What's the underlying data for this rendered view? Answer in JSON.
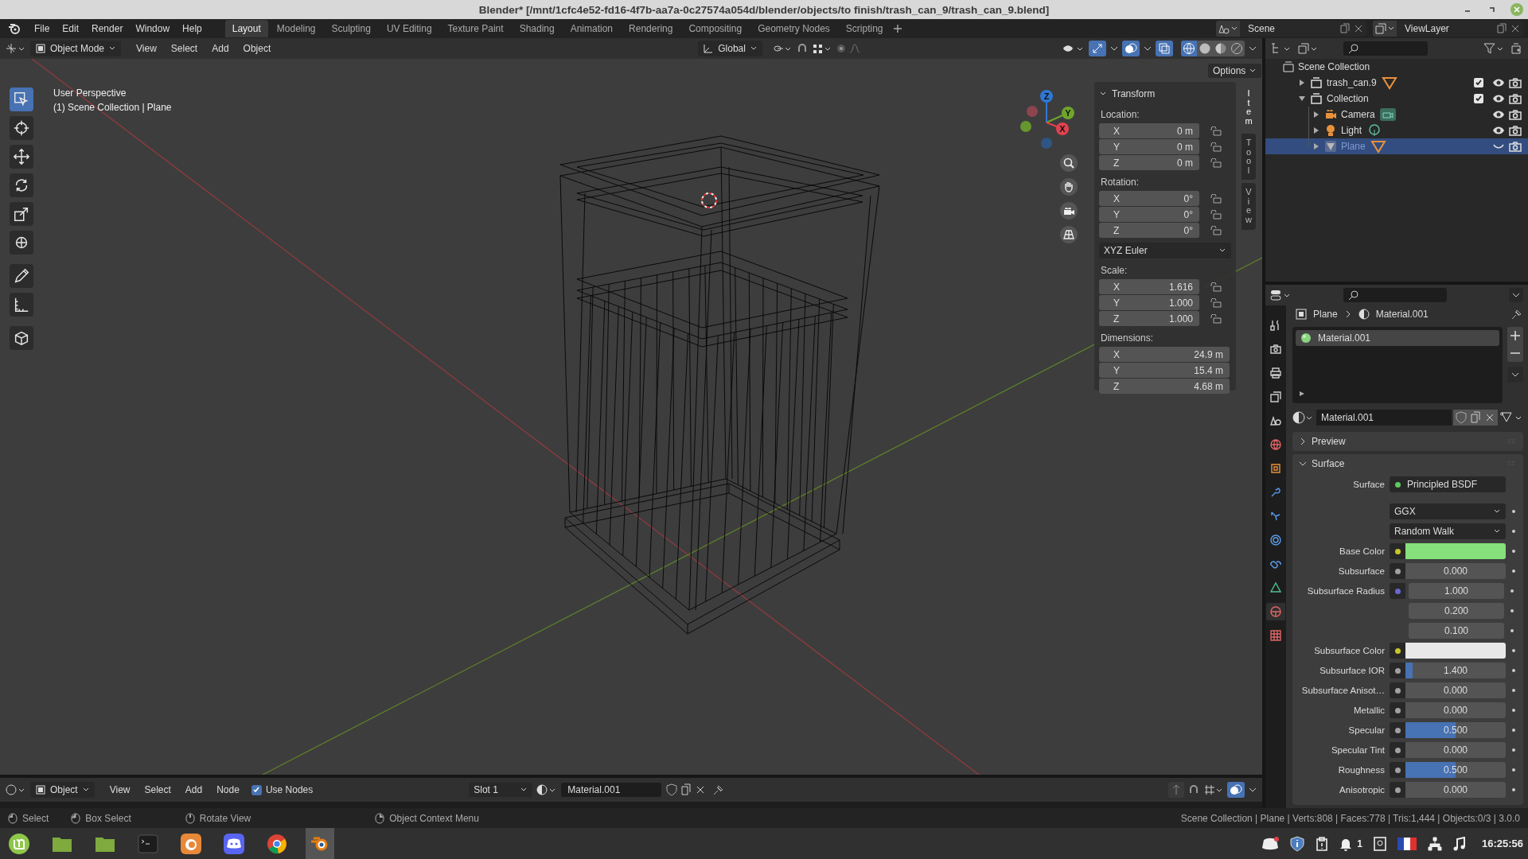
{
  "window": {
    "title": "Blender* [/mnt/1cfc4e52-fd16-4f7b-aa7a-0c27574a054d/blender/objects/to finish/trash_can_9/trash_can_9.blend]"
  },
  "menu_bar": {
    "items": [
      "File",
      "Edit",
      "Render",
      "Window",
      "Help"
    ]
  },
  "workspace_tabs": [
    {
      "label": "Layout",
      "selected": true
    },
    {
      "label": "Modeling",
      "selected": false
    },
    {
      "label": "Sculpting",
      "selected": false
    },
    {
      "label": "UV Editing",
      "selected": false
    },
    {
      "label": "Texture Paint",
      "selected": false
    },
    {
      "label": "Shading",
      "selected": false
    },
    {
      "label": "Animation",
      "selected": false
    },
    {
      "label": "Rendering",
      "selected": false
    },
    {
      "label": "Compositing",
      "selected": false
    },
    {
      "label": "Geometry Nodes",
      "selected": false
    },
    {
      "label": "Scripting",
      "selected": false
    }
  ],
  "scene": {
    "value": "Scene"
  },
  "view_layer": {
    "value": "ViewLayer"
  },
  "viewport": {
    "header": {
      "mode": "Object Mode",
      "menus": [
        "View",
        "Select",
        "Add",
        "Object"
      ],
      "orientation": "Global",
      "shading": [
        {
          "kind": "wireframe",
          "selected": true
        },
        {
          "kind": "solid",
          "selected": false
        },
        {
          "kind": "material",
          "selected": false
        },
        {
          "kind": "rendered",
          "selected": false
        }
      ]
    },
    "options": "Options",
    "tools": [
      {
        "kind": "select",
        "selected": true
      },
      {
        "kind": "cursor",
        "selected": false
      },
      {
        "kind": "move",
        "selected": false
      },
      {
        "kind": "rotate",
        "selected": false
      },
      {
        "kind": "scale",
        "selected": false
      },
      {
        "kind": "transform",
        "selected": false
      },
      {
        "kind": "annotate",
        "selected": false
      },
      {
        "kind": "measure",
        "selected": false
      },
      {
        "kind": "add",
        "selected": false
      }
    ],
    "overlay_text": [
      "User Perspective",
      "(1) Scene Collection | Plane"
    ],
    "gizmo_axes": [
      {
        "label": "Z",
        "color": "#2f78d4"
      },
      {
        "label": "Y",
        "color": "#6ea62c"
      },
      {
        "label": "X",
        "color": "#e2414f"
      }
    ],
    "sidebar_tabs": [
      {
        "label": "Item",
        "selected": true
      },
      {
        "label": "Tool",
        "selected": false
      },
      {
        "label": "View",
        "selected": false
      }
    ],
    "transform": {
      "title": "Transform",
      "expanded": true,
      "groups": [
        {
          "kind": "vector",
          "label": "Location:",
          "lockable": true,
          "fields": [
            {
              "axis": "X",
              "value": "0 m"
            },
            {
              "axis": "Y",
              "value": "0 m"
            },
            {
              "axis": "Z",
              "value": "0 m"
            }
          ]
        },
        {
          "kind": "vector",
          "label": "Rotation:",
          "lockable": true,
          "fields": [
            {
              "axis": "X",
              "value": "0°"
            },
            {
              "axis": "Y",
              "value": "0°"
            },
            {
              "axis": "Z",
              "value": "0°"
            }
          ]
        },
        {
          "kind": "dropdown",
          "value": "XYZ Euler"
        },
        {
          "kind": "vector",
          "label": "Scale:",
          "lockable": true,
          "fields": [
            {
              "axis": "X",
              "value": "1.616"
            },
            {
              "axis": "Y",
              "value": "1.000"
            },
            {
              "axis": "Z",
              "value": "1.000"
            }
          ]
        },
        {
          "kind": "vector",
          "label": "Dimensions:",
          "lockable": false,
          "fields": [
            {
              "axis": "X",
              "value": "24.9 m"
            },
            {
              "axis": "Y",
              "value": "15.4 m"
            },
            {
              "axis": "Z",
              "value": "4.68 m"
            }
          ]
        }
      ]
    }
  },
  "outliner": {
    "root": "Scene Collection",
    "items": [
      {
        "name": "trash_can.9",
        "kind": "collection",
        "data": [
          {
            "kind": "mesh"
          }
        ],
        "expanded": false,
        "checked": true,
        "visible": true,
        "selected": false
      },
      {
        "name": "Collection",
        "kind": "collection",
        "expanded": true,
        "checked": true,
        "visible": true,
        "selected": false,
        "children": [
          {
            "name": "Camera",
            "kind": "camera",
            "data": [
              {
                "kind": "camera"
              }
            ],
            "expanded": false,
            "visible": true,
            "selected": false
          },
          {
            "name": "Light",
            "kind": "light",
            "data": [
              {
                "kind": "light"
              }
            ],
            "expanded": false,
            "visible": true,
            "selected": false
          },
          {
            "name": "Plane",
            "kind": "mesh",
            "data": [
              {
                "kind": "mesh"
              }
            ],
            "expanded": false,
            "visible": false,
            "selected": true
          }
        ]
      }
    ]
  },
  "properties": {
    "tabs": [
      {
        "kind": "tool",
        "selected": false
      },
      {
        "kind": "render",
        "selected": false
      },
      {
        "kind": "output",
        "selected": false
      },
      {
        "kind": "view-layer",
        "selected": false
      },
      {
        "kind": "scene",
        "selected": false
      },
      {
        "kind": "world",
        "selected": false
      },
      {
        "kind": "object",
        "selected": false
      },
      {
        "kind": "modifier",
        "selected": false
      },
      {
        "kind": "particles",
        "selected": false
      },
      {
        "kind": "physics",
        "selected": false
      },
      {
        "kind": "constraints",
        "selected": false
      },
      {
        "kind": "data",
        "selected": false
      },
      {
        "kind": "material",
        "selected": true
      },
      {
        "kind": "texture",
        "selected": false
      }
    ],
    "breadcrumb": [
      "Plane",
      "Material.001"
    ],
    "slots": [
      {
        "name": "Material.001",
        "selected": true
      }
    ],
    "material": "Material.001",
    "panels": [
      {
        "title": "Preview",
        "expanded": false
      },
      {
        "title": "Surface",
        "expanded": true
      }
    ],
    "surface_rows": [
      {
        "kind": "shader",
        "label": "Surface",
        "value": "Principled BSDF"
      },
      {
        "kind": "dropdown",
        "value": "GGX"
      },
      {
        "kind": "dropdown",
        "value": "Random Walk"
      },
      {
        "kind": "color",
        "label": "Base Color",
        "color": "#86e07b"
      },
      {
        "kind": "number",
        "label": "Subsurface",
        "value": "0.000",
        "level": 0
      },
      {
        "kind": "vector",
        "label": "Subsurface Radius",
        "values": [
          "1.000",
          "0.200",
          "0.100"
        ]
      },
      {
        "kind": "color",
        "label": "Subsurface Color",
        "color": "#e8e8e8"
      },
      {
        "kind": "number",
        "label": "Subsurface IOR",
        "value": "1.400",
        "level": 0.07
      },
      {
        "kind": "number",
        "label": "Subsurface Anisot…",
        "value": "0.000",
        "level": 0
      },
      {
        "kind": "number",
        "label": "Metallic",
        "value": "0.000",
        "level": 0
      },
      {
        "kind": "number",
        "label": "Specular",
        "value": "0.500",
        "level": 0.5
      },
      {
        "kind": "number",
        "label": "Specular Tint",
        "value": "0.000",
        "level": 0
      },
      {
        "kind": "number",
        "label": "Roughness",
        "value": "0.500",
        "level": 0.5
      },
      {
        "kind": "number",
        "label": "Anisotropic",
        "value": "0.000",
        "level": 0
      }
    ]
  },
  "node_editor_header": {
    "mode": "Object",
    "menus": [
      "View",
      "Select",
      "Add",
      "Node"
    ],
    "use_nodes": {
      "label": "Use Nodes",
      "checked": true
    },
    "slot": "Slot 1",
    "material": "Material.001"
  },
  "status_bar": {
    "hints": [
      {
        "kind": "left",
        "label": "Select"
      },
      {
        "kind": "drag",
        "label": "Box Select"
      },
      {
        "kind": "middle",
        "label": "Rotate View"
      },
      {
        "kind": "right",
        "label": "Object Context Menu"
      }
    ],
    "stats": "Scene Collection | Plane | Verts:808 | Faces:778 | Tris:1,444 | Objects:0/3 | 3.0.0"
  },
  "taskbar": {
    "apps": [
      {
        "kind": "mint",
        "active": false
      },
      {
        "kind": "folder",
        "active": false
      },
      {
        "kind": "folder",
        "active": false
      },
      {
        "kind": "terminal",
        "active": false
      },
      {
        "kind": "firefox",
        "active": false
      },
      {
        "kind": "discord",
        "active": false
      },
      {
        "kind": "chrome",
        "active": false
      },
      {
        "kind": "blender",
        "active": true
      }
    ],
    "notification_count": "1",
    "clock": "16:25:56"
  }
}
